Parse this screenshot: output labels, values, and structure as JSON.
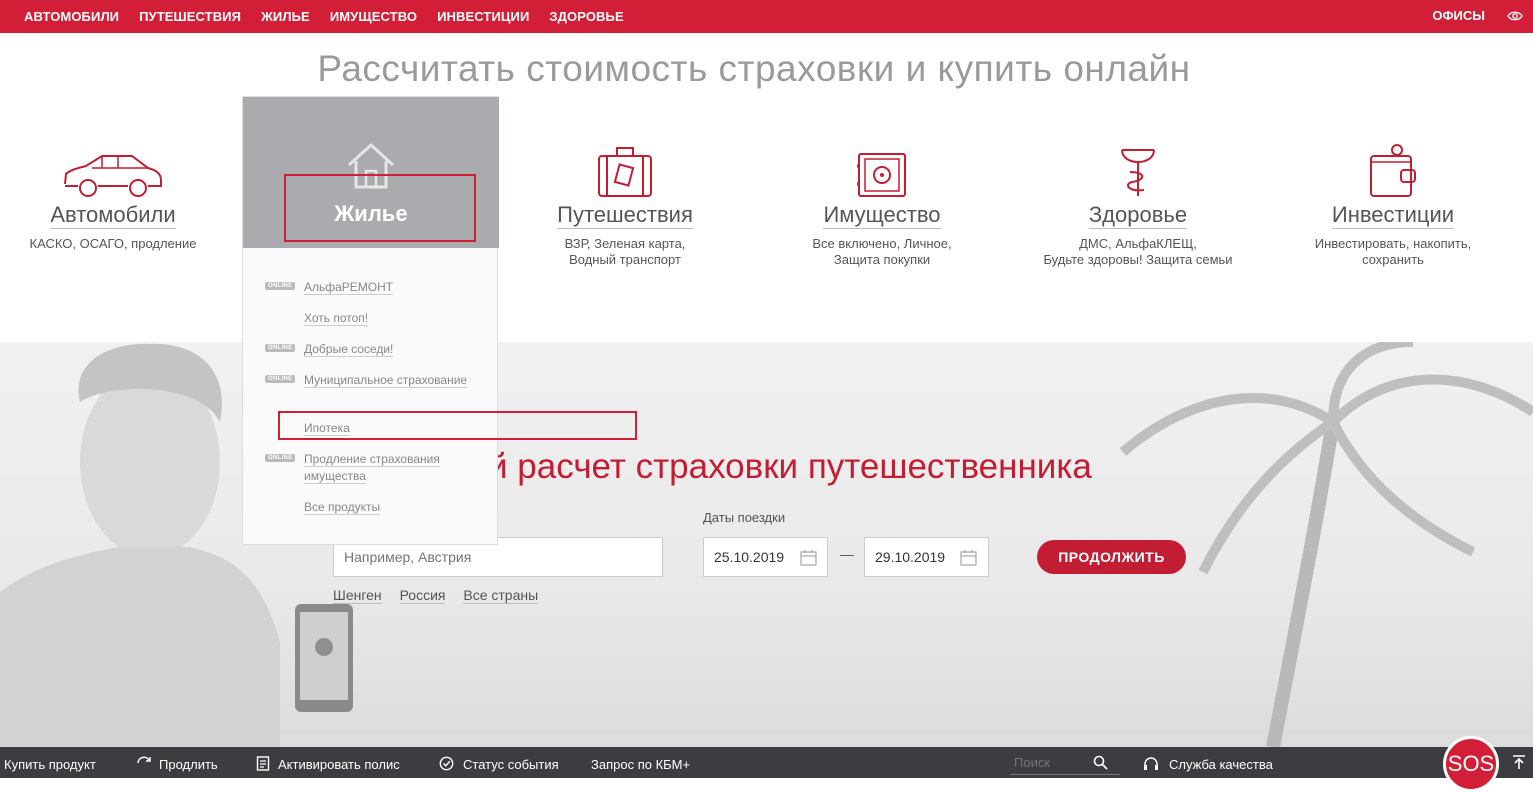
{
  "topnav": {
    "items": [
      "АВТОМОБИЛИ",
      "ПУТЕШЕСТВИЯ",
      "ЖИЛЬЕ",
      "ИМУЩЕСТВО",
      "ИНВЕСТИЦИИ",
      "ЗДОРОВЬЕ"
    ],
    "offices": "ОФИСЫ"
  },
  "headline": "Рассчитать стоимость страховки и купить онлайн",
  "categories": [
    {
      "name": "Автомобили",
      "sub1": "КАСКО, ОСАГО, продление",
      "sub2": "",
      "icon": "car-icon"
    },
    {
      "name": "Жилье",
      "sub1": "",
      "sub2": "",
      "icon": "house-icon"
    },
    {
      "name": "Путешествия",
      "sub1": "ВЗР, Зеленая карта,",
      "sub2": "Водный транспорт",
      "icon": "suitcase-icon"
    },
    {
      "name": "Имущество",
      "sub1": "Все включено, Личное,",
      "sub2": "Защита покупки",
      "icon": "safe-icon"
    },
    {
      "name": "Здоровье",
      "sub1": "ДМС, АльфаКЛЕЩ,",
      "sub2": "Будьте здоровы! Защита семьи",
      "icon": "medical-icon"
    },
    {
      "name": "Инвестиции",
      "sub1": "Инвестировать, накопить,",
      "sub2": "сохранить",
      "icon": "wallet-icon"
    }
  ],
  "dropdown": {
    "title": "Жилье",
    "badge": "ONLINE",
    "items": [
      {
        "label": "АльфаРЕМОНТ",
        "online": true
      },
      {
        "label": "Хоть потоп!",
        "online": false
      },
      {
        "label": "Добрые соседи!",
        "online": true
      },
      {
        "label": "Муниципальное страхование",
        "online": true
      },
      {
        "label": "Ипотека",
        "online": false
      },
      {
        "label": "Продление страхования имущества",
        "online": true
      },
      {
        "label": "Все продукты",
        "online": false
      }
    ]
  },
  "hero": {
    "title": "й расчет страховки путешественника",
    "country_placeholder": "Например, Австрия",
    "dates_label": "Даты поездки",
    "date_from": "25.10.2019",
    "date_to": "29.10.2019",
    "dash": "—",
    "continue_button": "ПРОДОЛЖИТЬ",
    "quick_links": [
      "Шенген",
      "Россия",
      "Все страны"
    ]
  },
  "bottombar": {
    "buy": "Купить продукт",
    "renew": "Продлить",
    "activate": "Активировать полис",
    "status": "Статус события",
    "kbm": "Запрос по КБМ+",
    "search_placeholder": "Поиск",
    "quality": "Служба качества",
    "sos": "SOS"
  },
  "colors": {
    "brand": "#d21e36",
    "dropdown_head": "#a9abaf",
    "bottombar": "#3b3d40"
  }
}
